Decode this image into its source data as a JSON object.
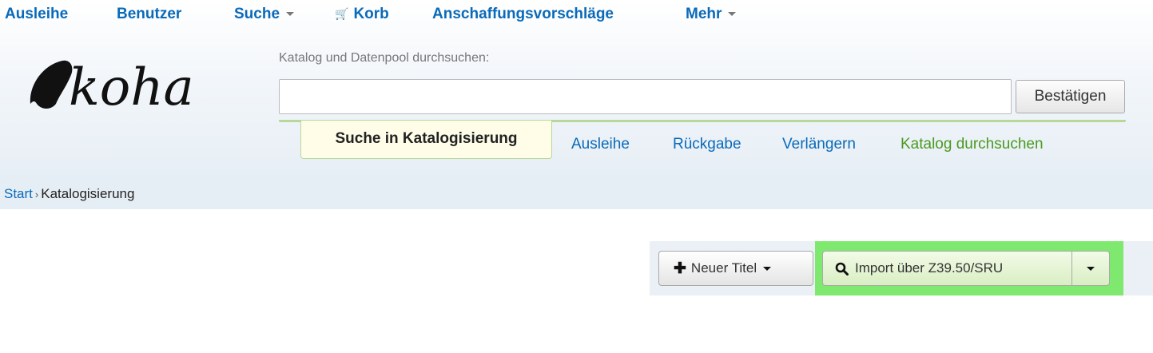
{
  "topnav": {
    "items": [
      {
        "label": "Ausleihe"
      },
      {
        "label": "Benutzer"
      },
      {
        "label": "Suche"
      },
      {
        "label": "Korb"
      },
      {
        "label": "Anschaffungsvorschläge"
      },
      {
        "label": "Mehr"
      }
    ]
  },
  "logo": {
    "text": "koha"
  },
  "search": {
    "label": "Katalog und Datenpool durchsuchen:",
    "value": "",
    "submit_label": "Bestätigen"
  },
  "search_tabs": {
    "active": "Suche in Katalogisierung",
    "items": [
      "Ausleihe",
      "Rückgabe",
      "Verlängern",
      "Katalog durchsuchen"
    ]
  },
  "breadcrumb": {
    "home": "Start",
    "separator": "›",
    "current": "Katalogisierung"
  },
  "toolbar": {
    "new_record_label": "Neuer Titel",
    "import_label": "Import über Z39.50/SRU"
  },
  "colors": {
    "link": "#0a6ab9",
    "green_link": "#4b9a1f",
    "highlight": "#7ee86f",
    "tab_border": "#b6d89b"
  },
  "icons": [
    "cart-icon",
    "plus-icon",
    "search-icon",
    "caret-down-icon",
    "koha-logo-leaf"
  ]
}
